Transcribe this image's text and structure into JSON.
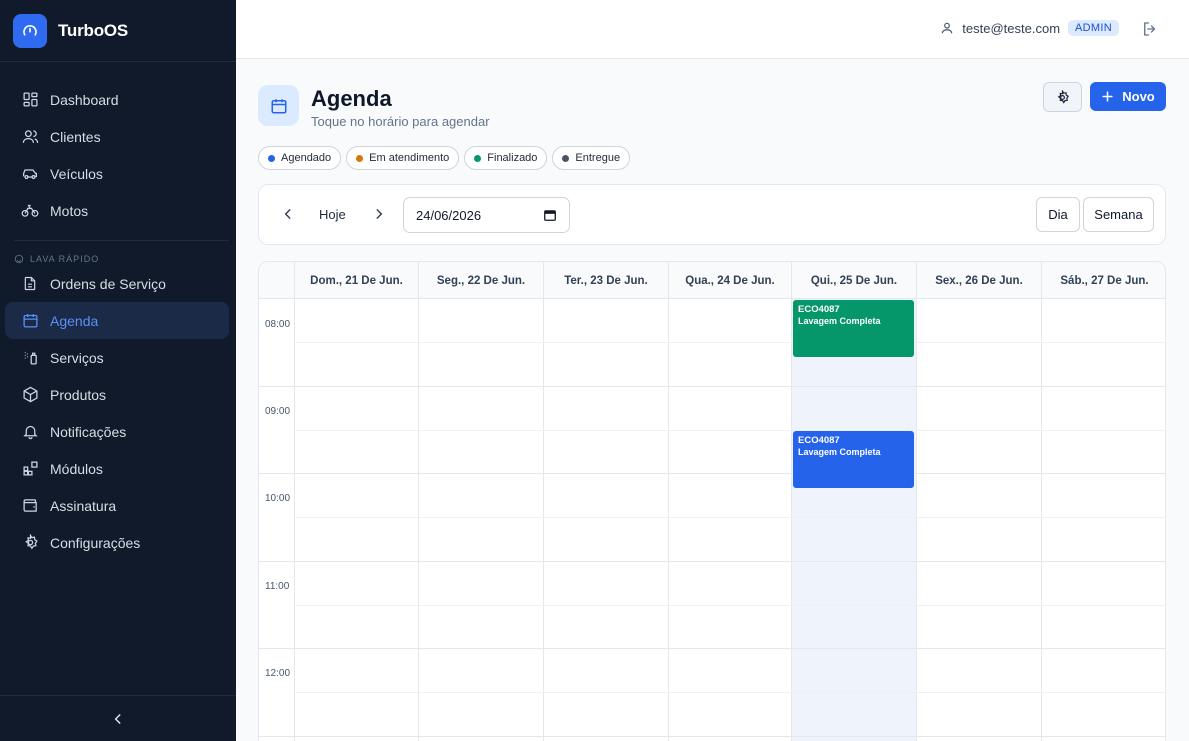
{
  "app": {
    "name": "TurboOS"
  },
  "sidebar": {
    "items": [
      {
        "label": "Dashboard"
      },
      {
        "label": "Clientes"
      },
      {
        "label": "Veículos"
      },
      {
        "label": "Motos"
      }
    ],
    "section_label": "LAVA RÁPIDO",
    "section_items": [
      {
        "label": "Ordens de Serviço"
      },
      {
        "label": "Agenda"
      },
      {
        "label": "Serviços"
      },
      {
        "label": "Produtos"
      },
      {
        "label": "Notificações"
      },
      {
        "label": "Módulos"
      },
      {
        "label": "Assinatura"
      },
      {
        "label": "Configurações"
      }
    ]
  },
  "user": {
    "email": "teste@teste.com",
    "role": "ADMIN"
  },
  "page": {
    "title": "Agenda",
    "subtitle": "Toque no horário para agendar",
    "new_label": "Novo"
  },
  "legend": [
    {
      "label": "Agendado",
      "color": "#2563eb"
    },
    {
      "label": "Em atendimento",
      "color": "#d97706"
    },
    {
      "label": "Finalizado",
      "color": "#059669"
    },
    {
      "label": "Entregue",
      "color": "#4b5563"
    }
  ],
  "toolbar": {
    "today_label": "Hoje",
    "date_value": "24/06/2026",
    "day_label": "Dia",
    "week_label": "Semana"
  },
  "calendar": {
    "days": [
      "Dom., 21 De Jun.",
      "Seg., 22 De Jun.",
      "Ter., 23 De Jun.",
      "Qua., 24 De Jun.",
      "Qui., 25 De Jun.",
      "Sex., 26 De Jun.",
      "Sáb., 27 De Jun."
    ],
    "times": [
      "08:00",
      "09:00",
      "10:00",
      "11:00",
      "12:00"
    ],
    "events": [
      {
        "code": "ECO4087",
        "service": "Lavagem Completa",
        "day": "Qui., 25 De Jun.",
        "color": "#059669"
      },
      {
        "code": "ECO4087",
        "service": "Lavagem Completa",
        "day": "Qui., 25 De Jun.",
        "color": "#2563eb"
      }
    ]
  }
}
